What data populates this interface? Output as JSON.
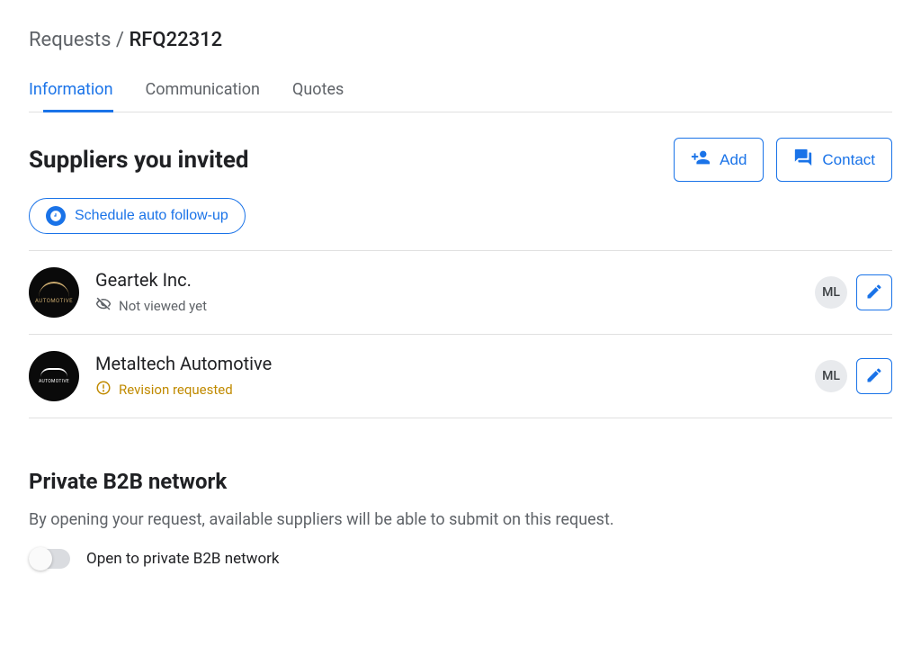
{
  "breadcrumb": {
    "parent": "Requests",
    "separator": "/",
    "current": "RFQ22312"
  },
  "tabs": [
    {
      "label": "Information",
      "active": true
    },
    {
      "label": "Communication",
      "active": false
    },
    {
      "label": "Quotes",
      "active": false
    }
  ],
  "section": {
    "title": "Suppliers you invited",
    "add_label": "Add",
    "contact_label": "Contact",
    "followup_label": "Schedule auto follow-up"
  },
  "suppliers": [
    {
      "name": "Geartek Inc.",
      "status": "Not viewed yet",
      "status_type": "not_viewed",
      "initials": "ML"
    },
    {
      "name": "Metaltech Automotive",
      "status": "Revision requested",
      "status_type": "revision",
      "initials": "ML"
    }
  ],
  "private": {
    "title": "Private B2B network",
    "description": "By opening your request, available suppliers will be able to submit on this request.",
    "toggle_label": "Open to private B2B network",
    "toggle_on": false
  }
}
